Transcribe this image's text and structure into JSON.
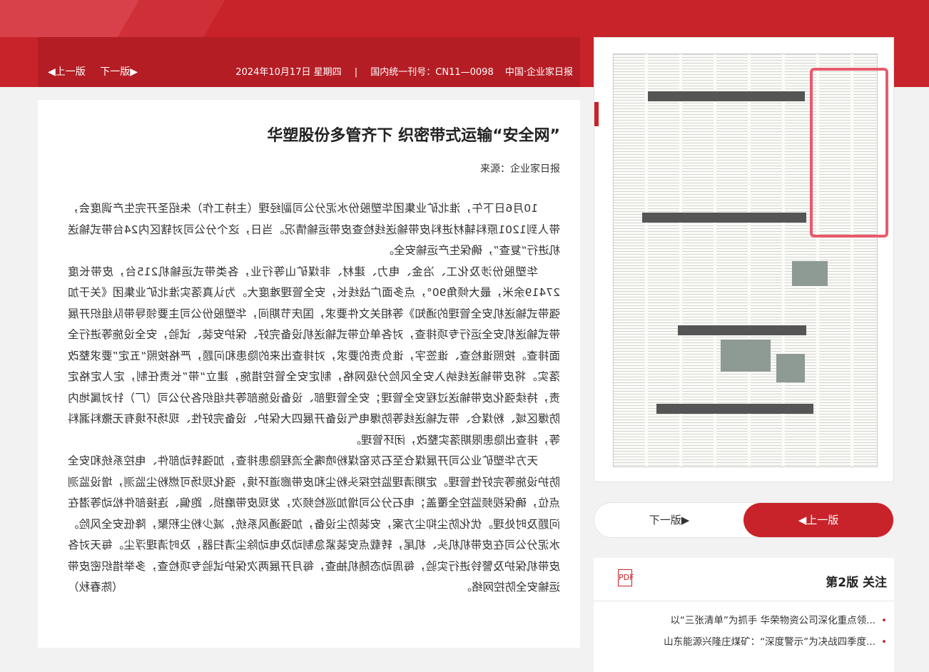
{
  "header": {
    "prev_label": "◀上一版",
    "next_label": "下一版▶",
    "date": "2024年10月17日 星期四",
    "issn": "国内统一刊号：CN11—0098",
    "paper_name": "中国·企业家日报"
  },
  "article": {
    "title": "华塑股份多管齐下 织密带式运输“安全网”",
    "source": "来源：企业家日报",
    "paragraphs": [
      "10月6日下午，淮北矿业集团华塑股份水泥分公司副经理（主持工作）朱绍圣开完生产调度会，带人到1201原料辅材进料皮带输送线检查皮带运输情况。当日，这个分公司对辖区内24台带式输送机进行“复查”，确保生产运输安全。",
      "华塑股份涉及化工、冶金、电力、建材、非煤矿山等行业，各类带式运输机215台，皮带长度27419余米，最大倾角90°，点多面广战线长，安全管理难度大。为认真落实淮北矿业集团《关于加强带式输送机安全管理的通知》等相关文件要求，国庆节期间，华塑股份公司主要领导带队组织开展带式输送机安全运行专项排查，对各单位带式输送机设备完好、保护安装、试验，安全设施等进行全面排查。按照谁检查、谁签字，谁负责的要求，对排查出来的隐患和问题，严格按照“五定”要求整改落实。将皮带输送线纳入安全风险分级网格，制定安全管控措施，建立“带”长责任制，定人定格定责，持续强化皮带输送过程安全管理；安全管理部、设备设施部等共组织各分公司（厂）针对属地内防爆区域、粉煤仓、带式输送线等防爆电气设备开展四大保护、设备完好性、现场环境有无撒料漏料等，排查出隐患限期落实整改，闭环管理。",
      "天方华塑矿业公司开展煤仓至石灰窑煤粉喷嘴全流程隐患排查，加强转动部件、电控系统和安全防护设施等完好性管理。定期清理监控探头粉尘和皮带廊道环境，强化现场可燃粉尘监测，增设监测点位，确保视频监控全覆盖；电石分公司增加巡检频次，发现皮带磨损、跑偏、连接部件松动等潜在问题及时处理。优化防尘抑尘方案，安装防尘设备，加强通风系统，减少粉尘积聚，降低安全风险。水泥分公司在皮带机机头、机尾，转载点安装紧急制动及电动除尘清扫器，及时清理浮尘。每天对各皮带机保护及警铃进行实验，每周动态随机抽查，每月开展两次保护试验专项检查，多举措织密皮带运输安全防控网络。"
    ],
    "author": "（陈春秋）"
  },
  "sidebar": {
    "next_btn": "下一版▶",
    "prev_btn": "◀上一版",
    "section_title": "第2版 关注",
    "pdf_label": "PDF",
    "news": [
      "以“三张清单”为抓手 华荣物资公司深化重点领...",
      "山东能源兴隆庄煤矿：“深度警示”为决战四季度..."
    ]
  },
  "colors": {
    "brand_red": "#c8232a",
    "header_red": "#b51d24",
    "highlight_pink": "#e85a6c"
  }
}
